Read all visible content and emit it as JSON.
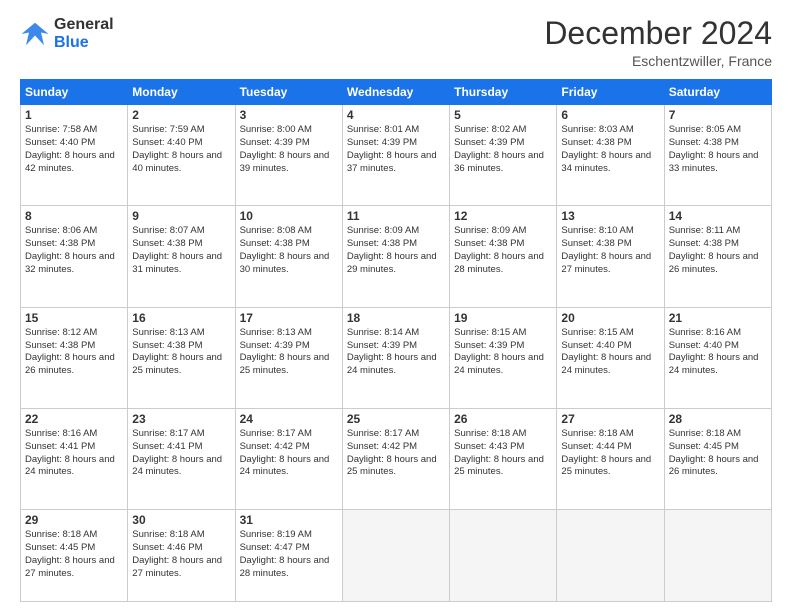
{
  "logo": {
    "line1": "General",
    "line2": "Blue"
  },
  "title": "December 2024",
  "subtitle": "Eschentzwiller, France",
  "days_header": [
    "Sunday",
    "Monday",
    "Tuesday",
    "Wednesday",
    "Thursday",
    "Friday",
    "Saturday"
  ],
  "weeks": [
    [
      {
        "day": 1,
        "sunrise": "7:58 AM",
        "sunset": "4:40 PM",
        "daylight": "8 hours and 42 minutes."
      },
      {
        "day": 2,
        "sunrise": "7:59 AM",
        "sunset": "4:40 PM",
        "daylight": "8 hours and 40 minutes."
      },
      {
        "day": 3,
        "sunrise": "8:00 AM",
        "sunset": "4:39 PM",
        "daylight": "8 hours and 39 minutes."
      },
      {
        "day": 4,
        "sunrise": "8:01 AM",
        "sunset": "4:39 PM",
        "daylight": "8 hours and 37 minutes."
      },
      {
        "day": 5,
        "sunrise": "8:02 AM",
        "sunset": "4:39 PM",
        "daylight": "8 hours and 36 minutes."
      },
      {
        "day": 6,
        "sunrise": "8:03 AM",
        "sunset": "4:38 PM",
        "daylight": "8 hours and 34 minutes."
      },
      {
        "day": 7,
        "sunrise": "8:05 AM",
        "sunset": "4:38 PM",
        "daylight": "8 hours and 33 minutes."
      }
    ],
    [
      {
        "day": 8,
        "sunrise": "8:06 AM",
        "sunset": "4:38 PM",
        "daylight": "8 hours and 32 minutes."
      },
      {
        "day": 9,
        "sunrise": "8:07 AM",
        "sunset": "4:38 PM",
        "daylight": "8 hours and 31 minutes."
      },
      {
        "day": 10,
        "sunrise": "8:08 AM",
        "sunset": "4:38 PM",
        "daylight": "8 hours and 30 minutes."
      },
      {
        "day": 11,
        "sunrise": "8:09 AM",
        "sunset": "4:38 PM",
        "daylight": "8 hours and 29 minutes."
      },
      {
        "day": 12,
        "sunrise": "8:09 AM",
        "sunset": "4:38 PM",
        "daylight": "8 hours and 28 minutes."
      },
      {
        "day": 13,
        "sunrise": "8:10 AM",
        "sunset": "4:38 PM",
        "daylight": "8 hours and 27 minutes."
      },
      {
        "day": 14,
        "sunrise": "8:11 AM",
        "sunset": "4:38 PM",
        "daylight": "8 hours and 26 minutes."
      }
    ],
    [
      {
        "day": 15,
        "sunrise": "8:12 AM",
        "sunset": "4:38 PM",
        "daylight": "8 hours and 26 minutes."
      },
      {
        "day": 16,
        "sunrise": "8:13 AM",
        "sunset": "4:38 PM",
        "daylight": "8 hours and 25 minutes."
      },
      {
        "day": 17,
        "sunrise": "8:13 AM",
        "sunset": "4:39 PM",
        "daylight": "8 hours and 25 minutes."
      },
      {
        "day": 18,
        "sunrise": "8:14 AM",
        "sunset": "4:39 PM",
        "daylight": "8 hours and 24 minutes."
      },
      {
        "day": 19,
        "sunrise": "8:15 AM",
        "sunset": "4:39 PM",
        "daylight": "8 hours and 24 minutes."
      },
      {
        "day": 20,
        "sunrise": "8:15 AM",
        "sunset": "4:40 PM",
        "daylight": "8 hours and 24 minutes."
      },
      {
        "day": 21,
        "sunrise": "8:16 AM",
        "sunset": "4:40 PM",
        "daylight": "8 hours and 24 minutes."
      }
    ],
    [
      {
        "day": 22,
        "sunrise": "8:16 AM",
        "sunset": "4:41 PM",
        "daylight": "8 hours and 24 minutes."
      },
      {
        "day": 23,
        "sunrise": "8:17 AM",
        "sunset": "4:41 PM",
        "daylight": "8 hours and 24 minutes."
      },
      {
        "day": 24,
        "sunrise": "8:17 AM",
        "sunset": "4:42 PM",
        "daylight": "8 hours and 24 minutes."
      },
      {
        "day": 25,
        "sunrise": "8:17 AM",
        "sunset": "4:42 PM",
        "daylight": "8 hours and 25 minutes."
      },
      {
        "day": 26,
        "sunrise": "8:18 AM",
        "sunset": "4:43 PM",
        "daylight": "8 hours and 25 minutes."
      },
      {
        "day": 27,
        "sunrise": "8:18 AM",
        "sunset": "4:44 PM",
        "daylight": "8 hours and 25 minutes."
      },
      {
        "day": 28,
        "sunrise": "8:18 AM",
        "sunset": "4:45 PM",
        "daylight": "8 hours and 26 minutes."
      }
    ],
    [
      {
        "day": 29,
        "sunrise": "8:18 AM",
        "sunset": "4:45 PM",
        "daylight": "8 hours and 27 minutes."
      },
      {
        "day": 30,
        "sunrise": "8:18 AM",
        "sunset": "4:46 PM",
        "daylight": "8 hours and 27 minutes."
      },
      {
        "day": 31,
        "sunrise": "8:19 AM",
        "sunset": "4:47 PM",
        "daylight": "8 hours and 28 minutes."
      },
      null,
      null,
      null,
      null
    ]
  ]
}
